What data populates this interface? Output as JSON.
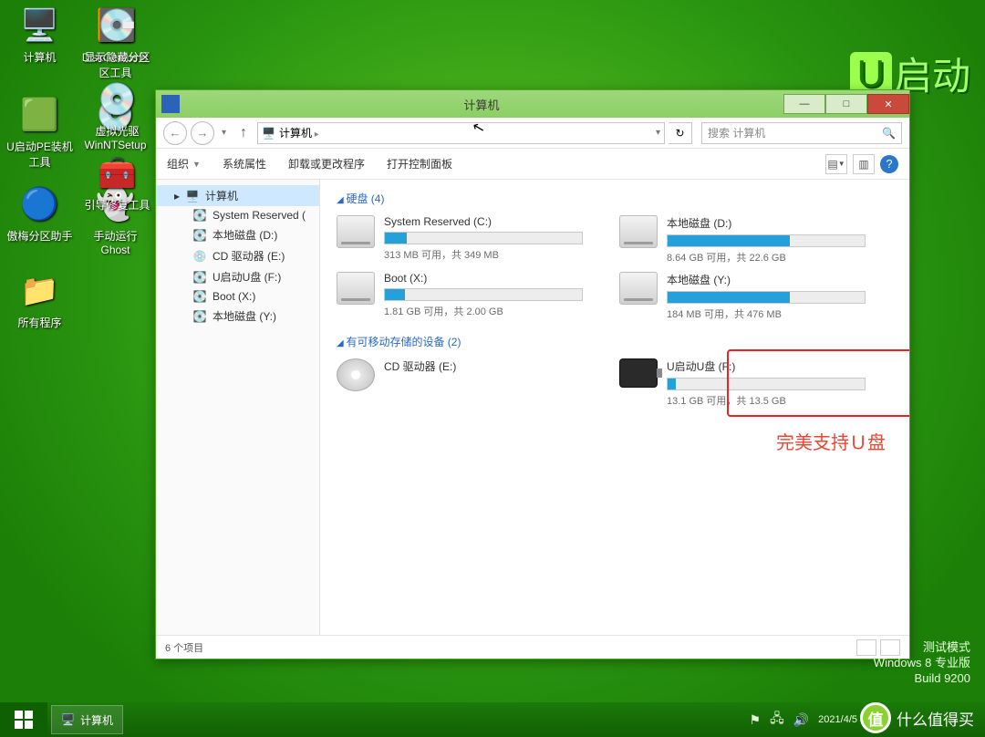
{
  "desktop_icons_col1": [
    {
      "name": "computer",
      "label": "计算机",
      "glyph": "🖥️"
    },
    {
      "name": "diskgenius",
      "label": "DiskGenius分区工具",
      "glyph": "🟧"
    },
    {
      "name": "uboot-pe",
      "label": "U启动PE装机工具",
      "glyph": "🟩"
    },
    {
      "name": "winntsetup",
      "label": "WinNTSetup",
      "glyph": "💿"
    },
    {
      "name": "aomei",
      "label": "傲梅分区助手",
      "glyph": "🔵"
    },
    {
      "name": "ghost",
      "label": "手动运行Ghost",
      "glyph": "👻"
    },
    {
      "name": "allprog",
      "label": "所有程序",
      "glyph": "📁"
    }
  ],
  "desktop_icons_col2": [
    {
      "name": "show-hidden",
      "label": "显示隐藏分区",
      "glyph": "💽"
    },
    {
      "name": "vcd",
      "label": "虚拟光驱",
      "glyph": "💿"
    },
    {
      "name": "boot-repair",
      "label": "引导修复工具",
      "glyph": "🧰"
    }
  ],
  "window": {
    "title": "计算机",
    "nav": {
      "back": "←",
      "fwd": "→",
      "up": "↑"
    },
    "breadcrumb": "计算机",
    "search_placeholder": "搜索 计算机",
    "refresh": "↻",
    "toolbar": {
      "org": "组织",
      "props": "系统属性",
      "uninstall": "卸载或更改程序",
      "ctrl": "打开控制面板"
    }
  },
  "tree": {
    "root": "计算机",
    "children": [
      {
        "label": "System Reserved (",
        "ico": "💽"
      },
      {
        "label": "本地磁盘 (D:)",
        "ico": "💽"
      },
      {
        "label": "CD 驱动器 (E:)",
        "ico": "💿"
      },
      {
        "label": "U启动U盘 (F:)",
        "ico": "💽"
      },
      {
        "label": "Boot (X:)",
        "ico": "💽"
      },
      {
        "label": "本地磁盘 (Y:)",
        "ico": "💽"
      }
    ]
  },
  "sections": {
    "hdd": "硬盘 (4)",
    "removable": "有可移动存储的设备 (2)"
  },
  "drives_hdd": [
    {
      "name": "System Reserved (C:)",
      "fill": 11,
      "stat": "313 MB 可用，共 349 MB"
    },
    {
      "name": "本地磁盘 (D:)",
      "fill": 62,
      "stat": "8.64 GB 可用，共 22.6 GB"
    },
    {
      "name": "Boot (X:)",
      "fill": 10,
      "stat": "1.81 GB 可用，共 2.00 GB"
    },
    {
      "name": "本地磁盘 (Y:)",
      "fill": 62,
      "stat": "184 MB 可用，共 476 MB"
    }
  ],
  "drives_removable": [
    {
      "name": "CD 驱动器 (E:)",
      "type": "cd"
    },
    {
      "name": "U启动U盘 (F:)",
      "type": "usb",
      "fill": 4,
      "stat": "13.1 GB 可用，共 13.5 GB"
    }
  ],
  "annotation": "完美支持Ｕ盘",
  "status": {
    "count": "6 个项目"
  },
  "brand": {
    "u": "U",
    "rest": "启动"
  },
  "watermark": {
    "l1": "测试模式",
    "l2": "Windows 8 专业版",
    "l3": "Build 9200"
  },
  "taskbar": {
    "task": "计算机",
    "date": "2021/4/5"
  },
  "zhi": {
    "char": "值",
    "text": "什么值得买"
  }
}
